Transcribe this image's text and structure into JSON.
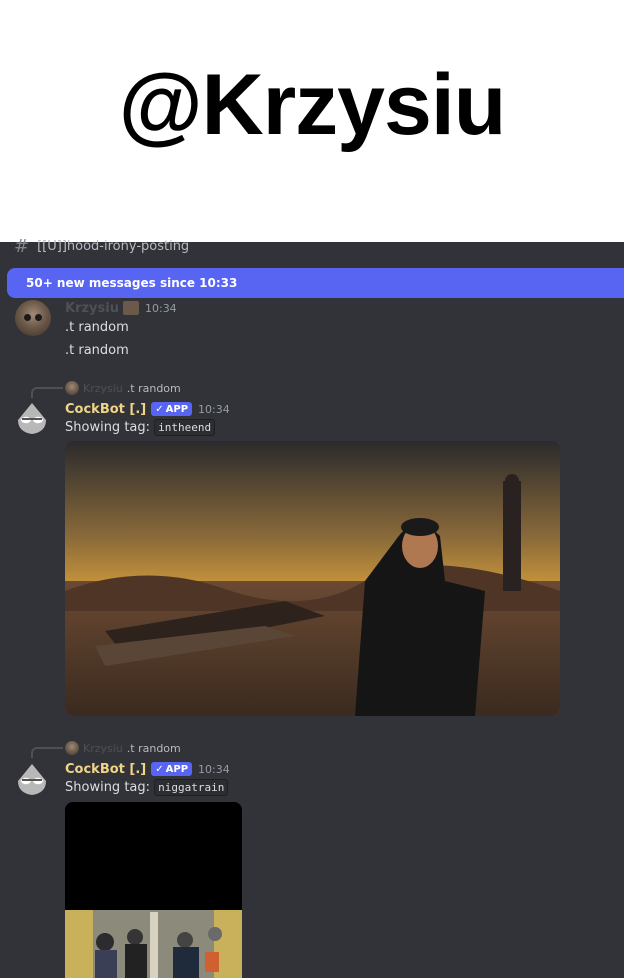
{
  "banner": {
    "title": "@Krzysiu"
  },
  "channel": {
    "hash": "#",
    "name": "[[U]]hood-irony-posting"
  },
  "new_messages": {
    "label": "50+ new messages since 10:33"
  },
  "messages": [
    {
      "author": "Krzysiu",
      "time": "10:34",
      "lines": [
        ".t random",
        ".t random"
      ]
    },
    {
      "reply": {
        "author": "Krzysiu",
        "text": ".t random"
      },
      "author": "CockBot [.]",
      "app_badge": "APP",
      "time": "10:34",
      "text_prefix": "Showing tag: ",
      "tag": "intheend"
    },
    {
      "reply": {
        "author": "Krzysiu",
        "text": ".t random"
      },
      "author": "CockBot [.]",
      "app_badge": "APP",
      "time": "10:34",
      "text_prefix": "Showing tag: ",
      "tag": "niggatrain"
    }
  ],
  "colors": {
    "bg": "#313338",
    "accent": "#5865f2",
    "bot_name": "#f0d487"
  }
}
